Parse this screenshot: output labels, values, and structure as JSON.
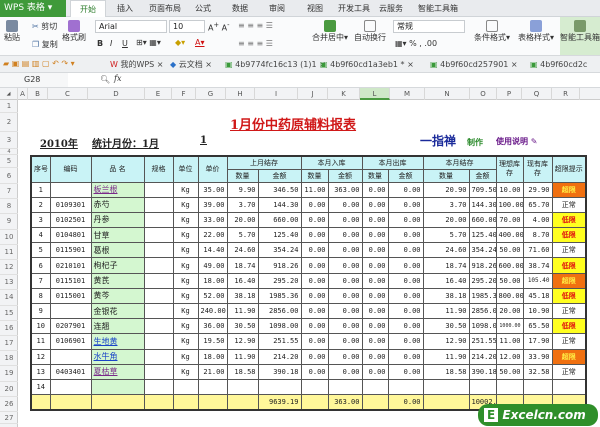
{
  "app": {
    "logo": "WPS 表格",
    "tabs": [
      "开始",
      "插入",
      "页面布局",
      "公式",
      "数据",
      "审阅",
      "视图",
      "开发工具",
      "云服务",
      "智能工具箱"
    ],
    "active_tab": 0
  },
  "ribbon": {
    "paste": "粘贴",
    "cut": "剪切",
    "copy": "复制",
    "format_painter": "格式刷",
    "font": "Arial",
    "size": "10",
    "bold": "B",
    "italic": "I",
    "underline": "U",
    "merge": "合并居中",
    "wrap": "自动换行",
    "number_format": "常规",
    "percent": "%",
    "cond_format": "条件格式",
    "table_style": "表格样式",
    "smart_toolbox": "智能工具箱"
  },
  "doc_tabs": [
    "我的WPS",
    "云文档",
    "4b9774fc16c13 (1)1",
    "4b9f60cd1a3eb1 *",
    "4b9f60cd257901",
    "4b9f60cd2c"
  ],
  "formula_bar": {
    "cell_ref": "G28",
    "fx": "fx",
    "value": ""
  },
  "columns": [
    "A",
    "B",
    "C",
    "D",
    "E",
    "F",
    "G",
    "H",
    "I",
    "J",
    "K",
    "L",
    "M",
    "N",
    "O",
    "P",
    "Q",
    "R"
  ],
  "selected_column": "L",
  "row_numbers": [
    "1",
    "2",
    "3",
    "4",
    "5",
    "6",
    "7",
    "8",
    "9",
    "10",
    "11",
    "12",
    "13",
    "14",
    "15",
    "16",
    "17",
    "18",
    "19",
    "20",
    "26",
    "27"
  ],
  "sheet": {
    "title": "1月份中药原辅料报表",
    "year": "2010年",
    "month_label": "统计月份：1月",
    "month_num": "1",
    "author": "一指禅",
    "made": "制作",
    "help": "使用说明",
    "headers": {
      "seq": "序号",
      "code": "编码",
      "name": "品  名",
      "spec": "规格",
      "unit": "单位",
      "price": "单价",
      "prev": "上月结存",
      "in": "本月入库",
      "out": "本月出库",
      "end": "本月结存",
      "qty": "数量",
      "amt": "金额",
      "ideal": "理想库存",
      "current": "现有库存",
      "alert": "超限提示"
    },
    "rows": [
      [
        "1",
        "",
        "板兰根",
        "",
        "Kg",
        "35.00",
        "9.90",
        "346.50",
        "11.00",
        "363.00",
        "0.00",
        "0.00",
        "20.90",
        "709.50",
        "10.00",
        "29.90",
        "超限"
      ],
      [
        "2",
        "0109301",
        "赤芍",
        "",
        "Kg",
        "39.00",
        "3.70",
        "144.30",
        "0.00",
        "0.00",
        "0.00",
        "0.00",
        "3.70",
        "144.30",
        "100.00",
        "65.70",
        "正常"
      ],
      [
        "3",
        "0102501",
        "丹参",
        "",
        "Kg",
        "33.00",
        "20.00",
        "660.00",
        "0.00",
        "0.00",
        "0.00",
        "0.00",
        "20.00",
        "660.00",
        "70.00",
        "4.00",
        "低限"
      ],
      [
        "4",
        "0104801",
        "甘草",
        "",
        "Kg",
        "22.00",
        "5.70",
        "125.40",
        "0.00",
        "0.00",
        "0.00",
        "0.00",
        "5.70",
        "125.40",
        "400.00",
        "8.70",
        "低限"
      ],
      [
        "5",
        "0115901",
        "葛根",
        "",
        "Kg",
        "14.40",
        "24.60",
        "354.24",
        "0.00",
        "0.00",
        "0.00",
        "0.00",
        "24.60",
        "354.24",
        "50.00",
        "71.60",
        "正常"
      ],
      [
        "6",
        "0210101",
        "枸杞子",
        "",
        "Kg",
        "49.00",
        "18.74",
        "918.26",
        "0.00",
        "0.00",
        "0.00",
        "0.00",
        "18.74",
        "918.26",
        "600.00",
        "38.74",
        "低限"
      ],
      [
        "7",
        "0115101",
        "黄芪",
        "",
        "Kg",
        "18.00",
        "16.40",
        "295.20",
        "0.00",
        "0.00",
        "0.00",
        "0.00",
        "16.40",
        "295.20",
        "50.00",
        "105.40",
        "超限"
      ],
      [
        "8",
        "0115001",
        "黄芩",
        "",
        "Kg",
        "52.00",
        "38.18",
        "1985.36",
        "0.00",
        "0.00",
        "0.00",
        "0.00",
        "38.18",
        "1985.36",
        "800.00",
        "45.18",
        "低限"
      ],
      [
        "9",
        "",
        "金银花",
        "",
        "Kg",
        "240.00",
        "11.90",
        "2856.00",
        "0.00",
        "0.00",
        "0.00",
        "0.00",
        "11.90",
        "2856.00",
        "20.00",
        "10.90",
        "正常"
      ],
      [
        "10",
        "0207901",
        "连翘",
        "",
        "Kg",
        "36.00",
        "30.50",
        "1098.00",
        "0.00",
        "0.00",
        "0.00",
        "0.00",
        "30.50",
        "1098.00",
        "1000.00",
        "65.50",
        "低限"
      ],
      [
        "11",
        "0106901",
        "生地黄",
        "",
        "Kg",
        "19.50",
        "12.90",
        "251.55",
        "0.00",
        "0.00",
        "0.00",
        "0.00",
        "12.90",
        "251.55",
        "11.00",
        "17.90",
        "正常"
      ],
      [
        "12",
        "",
        "水牛角",
        "",
        "Kg",
        "18.00",
        "11.90",
        "214.20",
        "0.00",
        "0.00",
        "0.00",
        "0.00",
        "11.90",
        "214.20",
        "12.00",
        "33.90",
        "超限"
      ],
      [
        "13",
        "0403401",
        "夏枯草",
        "",
        "Kg",
        "21.00",
        "18.58",
        "390.18",
        "0.00",
        "0.00",
        "0.00",
        "0.00",
        "18.58",
        "390.18",
        "50.00",
        "32.58",
        "正常"
      ],
      [
        "14",
        "",
        "",
        "",
        "",
        "",
        "",
        "",
        "",
        "",
        "",
        "",
        "",
        "",
        "",
        "",
        ""
      ]
    ],
    "link_styles": {
      "板兰根": "p",
      "夏枯草": "p",
      "生地黄": "b",
      "水牛角": "b"
    },
    "totals": [
      "",
      "",
      "",
      "",
      "",
      "",
      "",
      "9639.19",
      "",
      "363.00",
      "",
      "0.00",
      "",
      "10002.19",
      "",
      "",
      ""
    ]
  },
  "watermark": "Excelcn.com",
  "colors": {
    "accent": "#3f9a3a",
    "header": "#c9f3f6",
    "name_col": "#d4f7d0",
    "total": "#fff79a",
    "over": "#f07010",
    "low": "#ffff20"
  }
}
